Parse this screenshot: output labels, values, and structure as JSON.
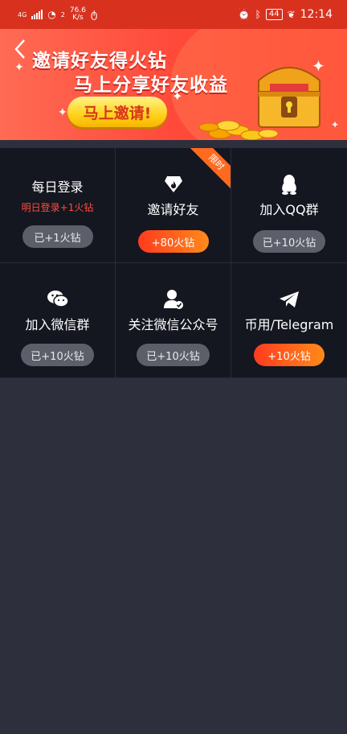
{
  "statusbar": {
    "net_speed": "76.6",
    "net_unit": "K/s",
    "network_tag": "4G",
    "signal_tag": "2",
    "battery": "44",
    "time": "12:14"
  },
  "banner": {
    "title": "邀请好友得火钻",
    "subtitle": "马上分享好友收益",
    "invite_label": "马上邀请!"
  },
  "tasks": [
    {
      "title": "每日登录",
      "subtitle": "明日登录+1火钻",
      "button": "已+1火钻",
      "status": "done"
    },
    {
      "title": "邀请好友",
      "badge": "限时",
      "button": "+80火钻",
      "status": "active",
      "icon": "diamond-flame-icon"
    },
    {
      "title": "加入QQ群",
      "button": "已+10火钻",
      "status": "done",
      "icon": "qq-icon"
    },
    {
      "title": "加入微信群",
      "button": "已+10火钻",
      "status": "done",
      "icon": "wechat-icon"
    },
    {
      "title": "关注微信公众号",
      "button": "已+10火钻",
      "status": "done",
      "icon": "user-verified-icon"
    },
    {
      "title": "币用/Telegram",
      "button": "+10火钻",
      "status": "active",
      "icon": "telegram-icon"
    }
  ],
  "colors": {
    "banner_bg": "#ff4a3a",
    "grid_bg": "#141620",
    "page_bg": "#2d2f3d",
    "accent_orange": "#ff8a1a",
    "accent_red": "#ff3b1f",
    "done_pill": "#5c5f69",
    "hint_red": "#ff4d3d"
  }
}
